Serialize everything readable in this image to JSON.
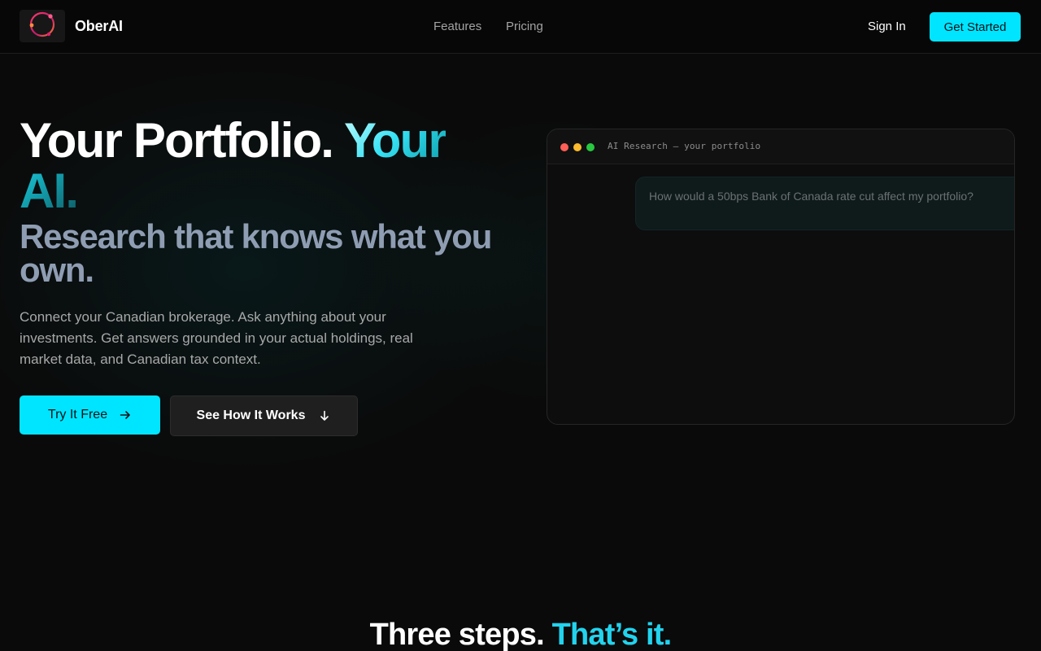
{
  "nav": {
    "brand": "OberAI",
    "links": [
      "Features",
      "Pricing"
    ],
    "sign_in": "Sign In",
    "get_started": "Get Started"
  },
  "hero": {
    "title_white": "Your Portfolio.",
    "title_accent": "Your AI.",
    "subtitle": "Research that knows what you own.",
    "description": "Connect your Canadian brokerage. Ask anything about your investments. Get answers grounded in your actual holdings, real market data, and Canadian tax context.",
    "primary_button": "Try It Free",
    "secondary_button": "See How It Works"
  },
  "demo_window": {
    "title": "AI Research — your portfolio",
    "user_message": "How would a 50bps Bank of Canada rate cut affect my portfolio?"
  },
  "section": {
    "title_white": "Three steps.",
    "title_accent": "That’s it."
  },
  "colors": {
    "accent": "#00e5ff",
    "background": "#0a0a0a"
  },
  "icons": {
    "logo": "ring-logo-icon",
    "primary_arrow": "arrow-right-icon",
    "secondary_arrow": "arrow-down-icon"
  }
}
